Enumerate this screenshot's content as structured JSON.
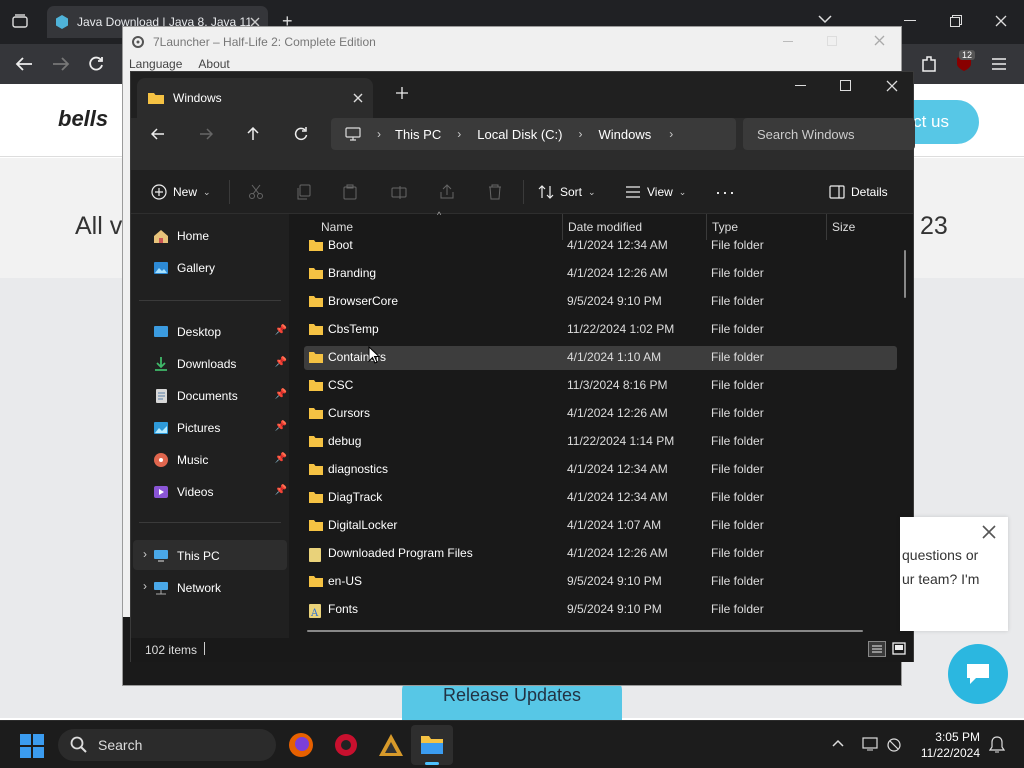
{
  "browser": {
    "tab_title": "Java Download | Java 8, Java 11",
    "new_tab_label": "+",
    "extension_badge": "12"
  },
  "website": {
    "logo_text": "bells",
    "contact_button": "ct us",
    "headline_left": "All v",
    "headline_right": "23",
    "release_button": "Release Updates",
    "chat_text_1": "questions or",
    "chat_text_2": "ur team? I'm"
  },
  "launcher": {
    "title": "7Launcher – Half-Life 2: Complete Edition",
    "menu": [
      "Language",
      "About"
    ]
  },
  "explorer": {
    "tab_title": "Windows",
    "breadcrumb": [
      "This PC",
      "Local Disk (C:)",
      "Windows"
    ],
    "search_placeholder": "Search Windows",
    "commands": {
      "new": "New",
      "sort": "Sort",
      "view": "View",
      "details": "Details"
    },
    "nav": {
      "home": "Home",
      "gallery": "Gallery",
      "desktop": "Desktop",
      "downloads": "Downloads",
      "documents": "Documents",
      "pictures": "Pictures",
      "music": "Music",
      "videos": "Videos",
      "this_pc": "This PC",
      "network": "Network"
    },
    "columns": {
      "name": "Name",
      "date": "Date modified",
      "type": "Type",
      "size": "Size"
    },
    "files": [
      {
        "name": "Boot",
        "date": "4/1/2024 12:34 AM",
        "type": "File folder"
      },
      {
        "name": "Branding",
        "date": "4/1/2024 12:26 AM",
        "type": "File folder"
      },
      {
        "name": "BrowserCore",
        "date": "9/5/2024 9:10 PM",
        "type": "File folder"
      },
      {
        "name": "CbsTemp",
        "date": "11/22/2024 1:02 PM",
        "type": "File folder"
      },
      {
        "name": "Containers",
        "date": "4/1/2024 1:10 AM",
        "type": "File folder"
      },
      {
        "name": "CSC",
        "date": "11/3/2024 8:16 PM",
        "type": "File folder"
      },
      {
        "name": "Cursors",
        "date": "4/1/2024 12:26 AM",
        "type": "File folder"
      },
      {
        "name": "debug",
        "date": "11/22/2024 1:14 PM",
        "type": "File folder"
      },
      {
        "name": "diagnostics",
        "date": "4/1/2024 12:34 AM",
        "type": "File folder"
      },
      {
        "name": "DiagTrack",
        "date": "4/1/2024 12:34 AM",
        "type": "File folder"
      },
      {
        "name": "DigitalLocker",
        "date": "4/1/2024 1:07 AM",
        "type": "File folder"
      },
      {
        "name": "Downloaded Program Files",
        "date": "4/1/2024 12:26 AM",
        "type": "File folder"
      },
      {
        "name": "en-US",
        "date": "9/5/2024 9:10 PM",
        "type": "File folder"
      },
      {
        "name": "Fonts",
        "date": "9/5/2024 9:10 PM",
        "type": "File folder"
      }
    ],
    "status": "102 items",
    "colors": {
      "folder": "#f5c243",
      "accent": "#4cc2ff",
      "hover_row": "#3d3d3d"
    }
  },
  "taskbar": {
    "search_label": "Search",
    "time": "3:05 PM",
    "date": "11/22/2024"
  }
}
